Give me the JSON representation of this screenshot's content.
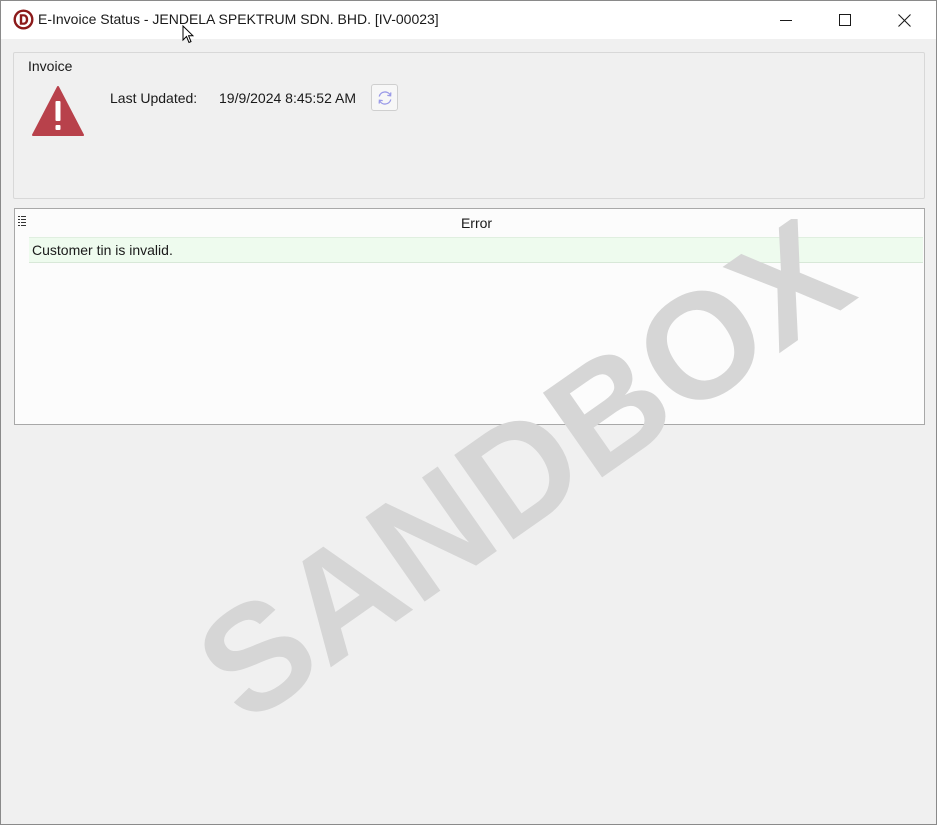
{
  "window": {
    "title": "E-Invoice Status - JENDELA SPEKTRUM SDN. BHD. [IV-00023]",
    "app_icon": "d-logo-icon",
    "controls": [
      "minimize-icon",
      "maximize-icon",
      "close-icon"
    ]
  },
  "invoice_group": {
    "legend": "Invoice",
    "status_icon": "warning-icon",
    "last_updated_label": "Last Updated:",
    "last_updated_value": "19/9/2024 8:45:52 AM",
    "refresh_icon": "refresh-icon"
  },
  "error_grid": {
    "column_header": "Error",
    "rows": [
      {
        "error": "Customer tin is invalid."
      }
    ]
  },
  "watermark": {
    "text": "SANDBOX"
  },
  "colors": {
    "warning": "#b8414b",
    "row_highlight": "#eefbee",
    "app_icon": "#8b1a1a",
    "watermark": "#d6d6d6"
  }
}
